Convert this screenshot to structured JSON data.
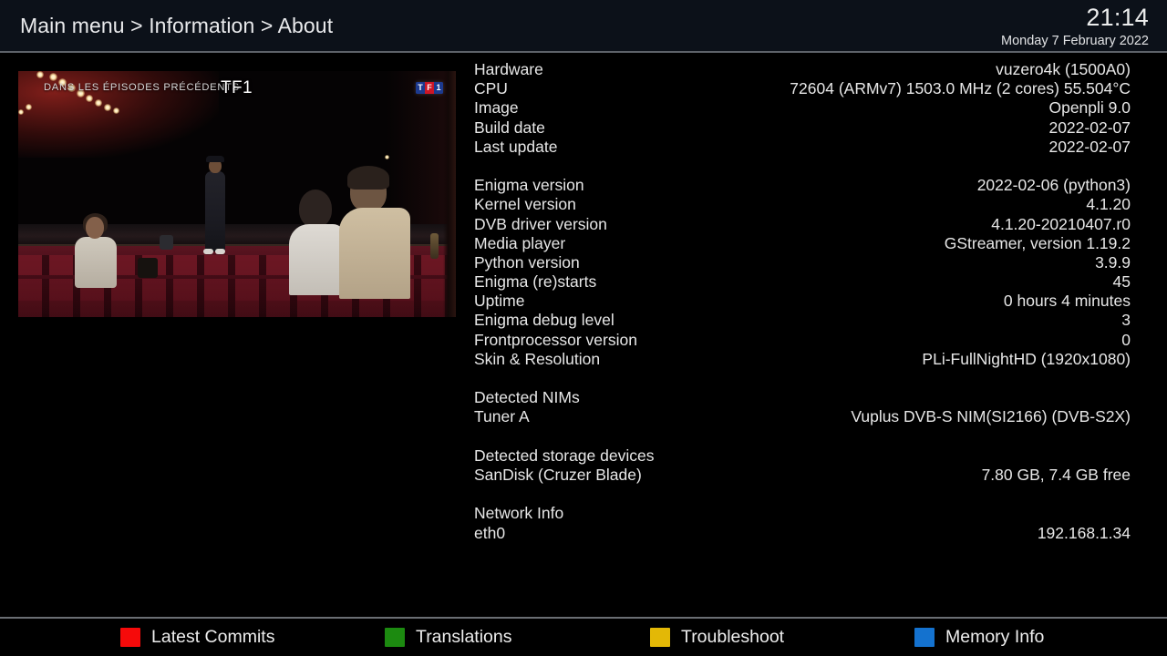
{
  "header": {
    "breadcrumb": "Main menu > Information > About",
    "clock_time": "21:14",
    "clock_date": "Monday  7 February 2022"
  },
  "video": {
    "subtitle_overlay": "DANS LES ÉPISODES PRÉCÉDENTS",
    "channel_name": "TF1",
    "logo_letters": [
      "T",
      "F",
      "1"
    ]
  },
  "info": {
    "group1": [
      {
        "label": "Hardware",
        "value": "vuzero4k (1500A0)"
      },
      {
        "label": "CPU",
        "value": "72604 (ARMv7) 1503.0 MHz (2 cores) 55.504°C"
      },
      {
        "label": "Image",
        "value": "Openpli 9.0"
      },
      {
        "label": "Build date",
        "value": "2022-02-07"
      },
      {
        "label": "Last update",
        "value": "2022-02-07"
      }
    ],
    "group2": [
      {
        "label": "Enigma version",
        "value": "2022-02-06 (python3)"
      },
      {
        "label": "Kernel version",
        "value": "4.1.20"
      },
      {
        "label": "DVB driver version",
        "value": "4.1.20-20210407.r0"
      },
      {
        "label": "Media player",
        "value": "GStreamer, version 1.19.2"
      },
      {
        "label": "Python version",
        "value": "3.9.9"
      },
      {
        "label": "Enigma (re)starts",
        "value": "45"
      },
      {
        "label": "Uptime",
        "value": "0 hours 4 minutes"
      },
      {
        "label": "Enigma debug level",
        "value": "3"
      },
      {
        "label": "Frontprocessor version",
        "value": "0"
      },
      {
        "label": "Skin & Resolution",
        "value": "PLi-FullNightHD (1920x1080)"
      }
    ],
    "group3": [
      {
        "label": "Detected NIMs",
        "value": ""
      },
      {
        "label": "Tuner A",
        "value": "Vuplus DVB-S NIM(SI2166) (DVB-S2X)"
      }
    ],
    "group4": [
      {
        "label": "Detected storage devices",
        "value": ""
      },
      {
        "label": "SanDisk (Cruzer Blade)",
        "value": "7.80 GB, 7.4 GB free"
      }
    ],
    "group5": [
      {
        "label": "Network Info",
        "value": ""
      },
      {
        "label": "eth0",
        "value": "192.168.1.34"
      }
    ]
  },
  "buttonbar": [
    {
      "label": "Latest Commits",
      "color": "#f60a0a"
    },
    {
      "label": "Translations",
      "color": "#1c8a10"
    },
    {
      "label": "Troubleshoot",
      "color": "#e3b806"
    },
    {
      "label": "Memory Info",
      "color": "#1472cf"
    }
  ]
}
